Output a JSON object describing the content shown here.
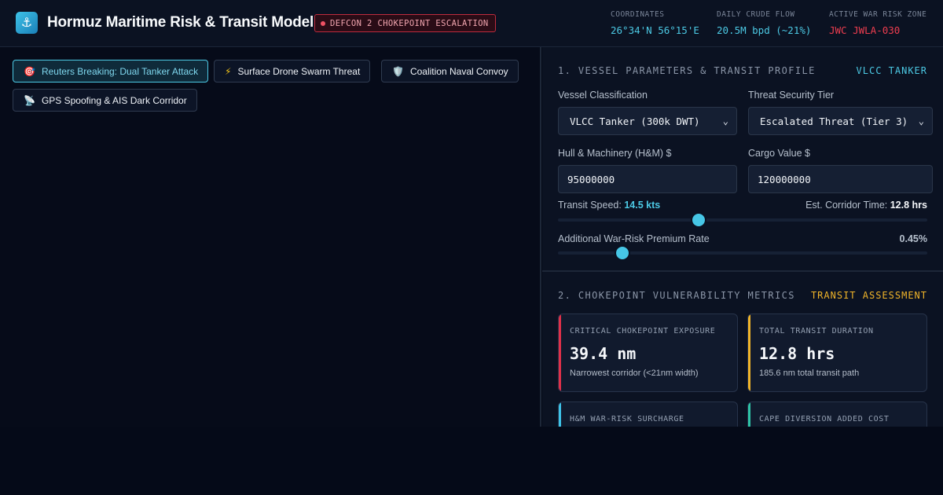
{
  "header": {
    "logo_icon": "anchor-icon",
    "title": "Hormuz Maritime Risk & Transit Model",
    "alert_badge": "DEFCON 2 CHOKEPOINT ESCALATION",
    "stats": [
      {
        "label": "COORDINATES",
        "value": "26°34'N 56°15'E",
        "color": "#4cc9e4"
      },
      {
        "label": "DAILY CRUDE FLOW",
        "value": "20.5M bpd (~21%)",
        "color": "#4cc9e4"
      },
      {
        "label": "ACTIVE WAR RISK ZONE",
        "value": "JWC JWLA-030",
        "color": "#ee3d4f"
      }
    ]
  },
  "scenarios": [
    {
      "label": "Reuters Breaking: Dual Tanker Attack",
      "icon": "target-icon",
      "glyph": "🎯",
      "active": true
    },
    {
      "label": "Surface Drone Swarm Threat",
      "icon": "lightning-icon",
      "glyph": "⚡",
      "active": false
    },
    {
      "label": "Coalition Naval Convoy",
      "icon": "shield-icon",
      "glyph": "🛡️",
      "active": false
    },
    {
      "label": "GPS Spoofing & AIS Dark Corridor",
      "icon": "satellite-icon",
      "glyph": "📡",
      "active": false
    }
  ],
  "vessel_section": {
    "title": "1. VESSEL PARAMETERS & TRANSIT PROFILE",
    "tag": "VLCC TANKER",
    "vessel_class_label": "Vessel Classification",
    "vessel_class_value": "VLCC Tanker (300k DWT)",
    "threat_tier_label": "Threat Security Tier",
    "threat_tier_value": "Escalated Threat (Tier 3)",
    "hull_label": "Hull & Machinery (H&M) $",
    "hull_value": "95000000",
    "cargo_label": "Cargo Value $",
    "cargo_value": "120000000",
    "speed_label": "Transit Speed:",
    "speed_value": "14.5 kts",
    "speed_level": 0.38,
    "corridor_label": "Est. Corridor Time:",
    "corridor_value": "12.8 hrs",
    "premium_label": "Additional War-Risk Premium Rate",
    "premium_value": "0.45%",
    "premium_level": 0.175
  },
  "metrics_section": {
    "title": "2. CHOKEPOINT VULNERABILITY METRICS",
    "tag": "TRANSIT ASSESSMENT",
    "cards": [
      {
        "label": "CRITICAL CHOKEPOINT EXPOSURE",
        "value": "39.4 nm",
        "sub": "Narrowest corridor (<21nm width)",
        "accent": "#e0304a"
      },
      {
        "label": "TOTAL TRANSIT DURATION",
        "value": "12.8 hrs",
        "sub": "185.6 nm total transit path",
        "accent": "#f0b429"
      },
      {
        "label": "H&M WAR-RISK SURCHARGE",
        "value": "",
        "sub": "",
        "accent": "#3ec3e8"
      },
      {
        "label": "CAPE DIVERSION ADDED COST",
        "value": "",
        "sub": "",
        "accent": "#2ec4a6"
      }
    ]
  },
  "colors": {
    "accent_cyan": "#4cc9e4",
    "alert_red": "#ee3d4f",
    "amber": "#f0b429"
  }
}
